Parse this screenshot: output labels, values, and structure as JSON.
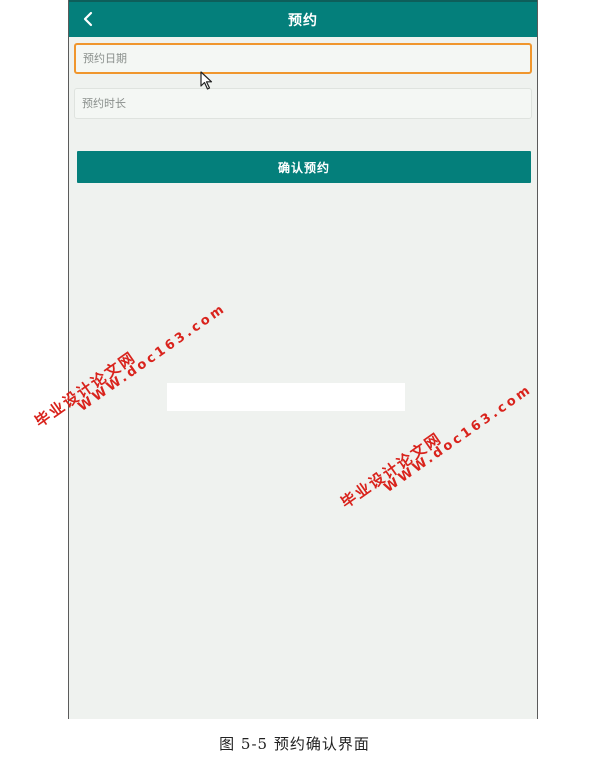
{
  "header": {
    "title": "预约",
    "back_icon": "chevron-left-icon"
  },
  "form": {
    "date_placeholder": "预约日期",
    "duration_placeholder": "预约时长",
    "confirm_label": "确认预约"
  },
  "colors": {
    "primary": "#047f7b",
    "focus_border": "#f0962d",
    "background": "#eff2ef",
    "watermark": "#d9231c"
  },
  "watermarks": [
    {
      "name": "毕业设计论文网",
      "url": "WWW.doc163.com"
    },
    {
      "name": "毕业设计论文网",
      "url": "WWW.doc163.com"
    }
  ],
  "caption": "图 5-5   预约确认界面"
}
